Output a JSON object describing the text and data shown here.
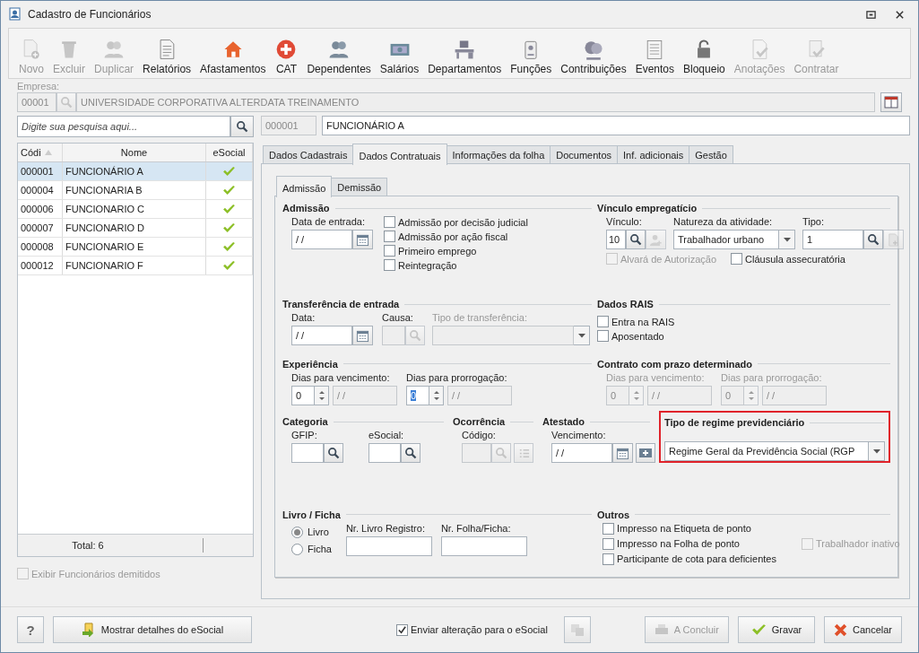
{
  "window": {
    "title": "Cadastro de Funcionários"
  },
  "toolbar": [
    {
      "label": "Novo",
      "disabled": true
    },
    {
      "label": "Excluir",
      "disabled": true
    },
    {
      "label": "Duplicar",
      "disabled": true
    },
    {
      "label": "Relatórios",
      "disabled": false
    },
    {
      "label": "Afastamentos",
      "disabled": false
    },
    {
      "label": "CAT",
      "disabled": false
    },
    {
      "label": "Dependentes",
      "disabled": false
    },
    {
      "label": "Salários",
      "disabled": false
    },
    {
      "label": "Departamentos",
      "disabled": false
    },
    {
      "label": "Funções",
      "disabled": false
    },
    {
      "label": "Contribuições",
      "disabled": false
    },
    {
      "label": "Eventos",
      "disabled": false
    },
    {
      "label": "Bloqueio",
      "disabled": false
    },
    {
      "label": "Anotações",
      "disabled": true
    },
    {
      "label": "Contratar",
      "disabled": true
    }
  ],
  "empresa": {
    "label": "Empresa:",
    "code": "00001",
    "name": "UNIVERSIDADE CORPORATIVA ALTERDATA TREINAMENTO"
  },
  "search": {
    "placeholder": "Digite sua pesquisa aqui..."
  },
  "employee": {
    "code": "000001",
    "name": "FUNCIONÁRIO A"
  },
  "table": {
    "columns": [
      "Códi",
      "Nome",
      "eSocial"
    ],
    "rows": [
      {
        "code": "000001",
        "name": "FUNCIONÁRIO A",
        "esocial": true,
        "selected": true
      },
      {
        "code": "000004",
        "name": "FUNCIONARIA B",
        "esocial": true,
        "selected": false
      },
      {
        "code": "000006",
        "name": "FUNCIONARIO C",
        "esocial": true,
        "selected": false
      },
      {
        "code": "000007",
        "name": "FUNCIONARIO D",
        "esocial": true,
        "selected": false
      },
      {
        "code": "000008",
        "name": "FUNCIONARIO E",
        "esocial": true,
        "selected": false
      },
      {
        "code": "000012",
        "name": "FUNCIONARIO F",
        "esocial": true,
        "selected": false
      }
    ],
    "total": "Total: 6"
  },
  "show_dismissed": {
    "label": "Exibir Funcionários demitidos",
    "checked": false,
    "disabled": true
  },
  "tabs": [
    {
      "label": "Dados Cadastrais",
      "selected": false
    },
    {
      "label": "Dados Contratuais",
      "selected": true
    },
    {
      "label": "Informações da folha",
      "selected": false
    },
    {
      "label": "Documentos",
      "selected": false
    },
    {
      "label": "Inf. adicionais",
      "selected": false
    },
    {
      "label": "Gestão",
      "selected": false
    }
  ],
  "subtabs": [
    {
      "label": "Admissão",
      "selected": true
    },
    {
      "label": "Demissão",
      "selected": false
    }
  ],
  "admissao": {
    "title": "Admissão",
    "date_label": "Data de entrada:",
    "date_value": "/ /",
    "checks": [
      {
        "label": "Admissão por decisão judicial",
        "checked": false
      },
      {
        "label": "Admissão por ação fiscal",
        "checked": false
      },
      {
        "label": "Primeiro emprego",
        "checked": false
      },
      {
        "label": "Reintegração",
        "checked": false
      }
    ]
  },
  "vinculo": {
    "title": "Vínculo empregatício",
    "vinculo_label": "Vínculo:",
    "vinculo_value": "10",
    "natureza_label": "Natureza da atividade:",
    "natureza_value": "Trabalhador urbano",
    "tipo_label": "Tipo:",
    "tipo_value": "1",
    "checks": [
      {
        "label": "Alvará de Autorização",
        "checked": false,
        "disabled": true
      },
      {
        "label": "Cláusula assecuratória",
        "checked": false,
        "disabled": false
      }
    ]
  },
  "transferencia": {
    "title": "Transferência de entrada",
    "data_label": "Data:",
    "data_value": "/ /",
    "causa_label": "Causa:",
    "tipo_label": "Tipo de transferência:"
  },
  "rais": {
    "title": "Dados RAIS",
    "checks": [
      {
        "label": "Entra na RAIS",
        "checked": false
      },
      {
        "label": "Aposentado",
        "checked": false
      }
    ]
  },
  "experiencia": {
    "title": "Experiência",
    "disabled": false,
    "fields": [
      {
        "label": "Dias para vencimento:",
        "days": "0",
        "date": "/ /",
        "focused": false
      },
      {
        "label": "Dias para prorrogação:",
        "days": "0",
        "date": "/ /",
        "focused": true
      }
    ]
  },
  "contrato": {
    "title": "Contrato com prazo determinado",
    "disabled": true,
    "fields": [
      {
        "label": "Dias para vencimento:",
        "days": "0",
        "date": "/ /",
        "focused": false
      },
      {
        "label": "Dias para prorrogação:",
        "days": "0",
        "date": "/ /",
        "focused": false
      }
    ]
  },
  "categoria": {
    "title": "Categoria",
    "gfip_label": "GFIP:",
    "esocial_label": "eSocial:"
  },
  "ocorrencia": {
    "title": "Ocorrência",
    "codigo_label": "Código:"
  },
  "atestado": {
    "title": "Atestado",
    "vencimento_label": "Vencimento:",
    "value": "/ /"
  },
  "regime": {
    "title": "Tipo de regime previdenciário",
    "value": "Regime Geral da Previdência Social (RGP",
    "highlighted": true
  },
  "livro": {
    "title": "Livro / Ficha",
    "options": [
      {
        "label": "Livro",
        "selected": true
      },
      {
        "label": "Ficha",
        "selected": false
      }
    ],
    "livro_label": "Nr. Livro Registro:",
    "folha_label": "Nr. Folha/Ficha:"
  },
  "outros": {
    "title": "Outros",
    "checks": [
      {
        "label": "Impresso na Etiqueta de ponto",
        "checked": false,
        "disabled": false
      },
      {
        "label": "Impresso na Folha de ponto",
        "checked": false,
        "disabled": false
      },
      {
        "label": "Trabalhador inativo",
        "checked": false,
        "disabled": true
      },
      {
        "label": "Participante de cota para deficientes",
        "checked": false,
        "disabled": false
      }
    ]
  },
  "footer": {
    "help": "?",
    "esocial_button": "Mostrar detalhes do eSocial",
    "send": {
      "label": "Enviar alteração para o eSocial",
      "checked": true
    },
    "buttons": [
      {
        "label": "A Concluir",
        "kind": "conclude",
        "disabled": true
      },
      {
        "label": "Gravar",
        "kind": "save",
        "disabled": false
      },
      {
        "label": "Cancelar",
        "kind": "cancel",
        "disabled": false
      }
    ]
  }
}
